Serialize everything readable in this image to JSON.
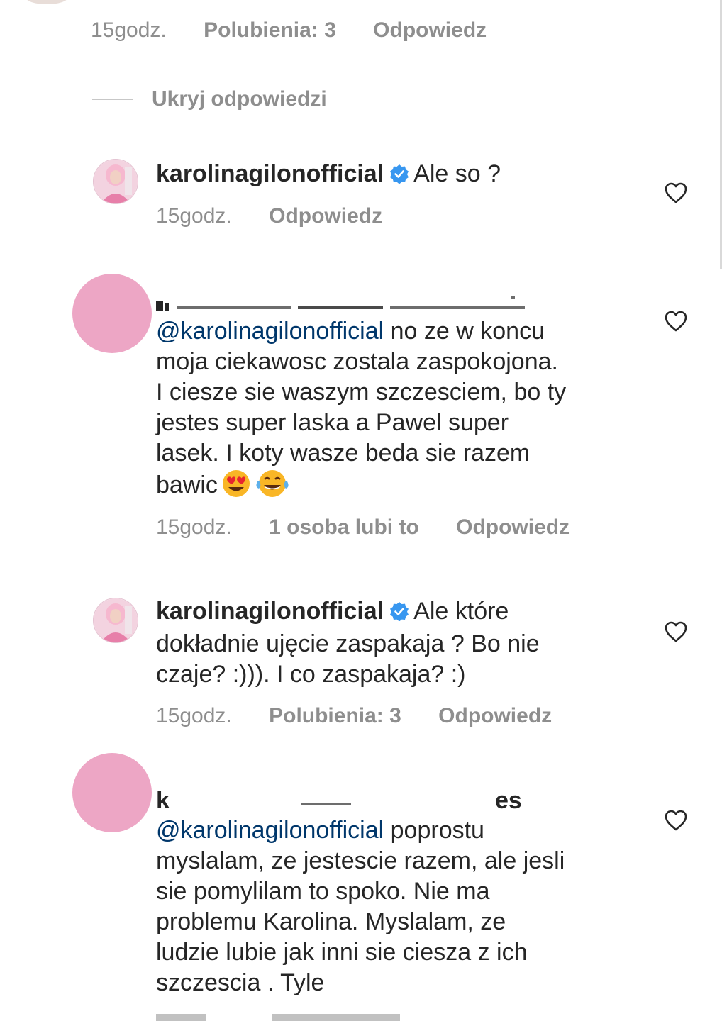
{
  "top_comment": {
    "time": "15godz.",
    "likes": "Polubienia: 3",
    "reply": "Odpowiedz"
  },
  "hide_replies": "Ukryj odpowiedzi",
  "reply1": {
    "username": "karolinagilonofficial",
    "text": "Ale so ?",
    "time": "15godz.",
    "reply": "Odpowiedz"
  },
  "reply2": {
    "mention": "@karolinagilonofficial",
    "text_lines": [
      "no ze w koncu",
      "moja ciekawosc zostala zaspokojona.",
      "I ciesze sie waszym szczesciem, bo ty",
      "jestes super laska a Pawel super",
      "lasek. I koty wasze beda sie razem",
      "bawic"
    ],
    "time": "15godz.",
    "likes": "1 osoba lubi to",
    "reply": "Odpowiedz"
  },
  "reply3": {
    "username": "karolinagilonofficial",
    "text_first": "Ale które",
    "text_lines": [
      "dokładnie ujęcie zaspakaja ? Bo nie",
      "czaje? :))). I co zaspakaja? :)"
    ],
    "time": "15godz.",
    "likes": "Polubienia: 3",
    "reply": "Odpowiedz"
  },
  "reply4": {
    "username_fragment_start": "k",
    "username_fragment_end": "es",
    "mention": "@karolinagilonofficial",
    "text_lines": [
      "poprostu",
      "myslalam, ze jestescie razem, ale jesli",
      "sie pomylilam to spoko. Nie ma",
      "problemu Karolina. Myslalam, ze",
      "ludzie lubie jak inni sie ciesza z ich",
      "szczescia . Tyle"
    ]
  },
  "colors": {
    "text": "#262626",
    "meta": "#8e8e8e",
    "mention": "#00376b",
    "verified": "#3897f0",
    "avatar_placeholder": "#eda6c5"
  },
  "icons": [
    "heart-outline-icon",
    "verified-badge-icon",
    "heart-eyes-emoji",
    "tears-of-joy-emoji"
  ]
}
